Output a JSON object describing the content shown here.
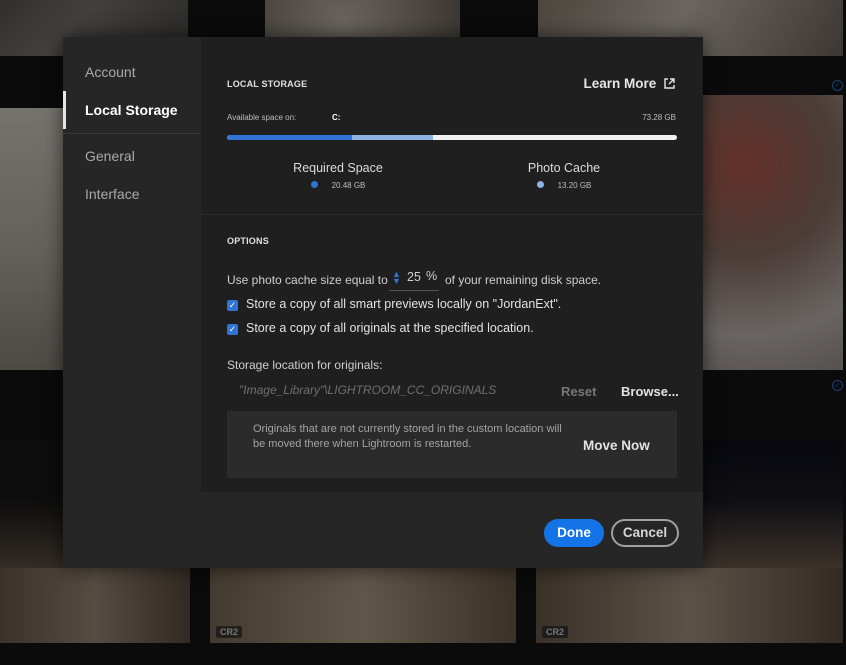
{
  "sidebar": {
    "items": [
      {
        "label": "Account",
        "active": false
      },
      {
        "label": "Local Storage",
        "active": true
      },
      {
        "label": "General",
        "active": false
      },
      {
        "label": "Interface",
        "active": false
      }
    ]
  },
  "local_storage": {
    "title": "LOCAL STORAGE",
    "learn_more": "Learn More",
    "available_label": "Available space on:",
    "drive": "C:",
    "available_value": "73.28 GB",
    "usage": {
      "required_fraction": 0.278,
      "cache_fraction": 0.18
    },
    "required_space": {
      "label": "Required Space",
      "value": "20.48 GB",
      "color": "#2f74d6"
    },
    "photo_cache": {
      "label": "Photo Cache",
      "value": "13.20 GB",
      "color": "#8db3e0"
    }
  },
  "options": {
    "title": "OPTIONS",
    "cache_prefix": "Use photo cache size equal to",
    "cache_value": "25",
    "cache_unit": "%",
    "cache_suffix": "of your remaining disk space.",
    "smart_previews_label": "Store a copy of all smart previews locally on \"JordanExt\".",
    "smart_previews_checked": true,
    "originals_label": "Store a copy of all originals at the specified location.",
    "originals_checked": true,
    "storage_location_label": "Storage location for originals:",
    "storage_path": "\"Image_Library\"\\LIGHTROOM_CC_ORIGINALS",
    "reset_label": "Reset",
    "browse_label": "Browse...",
    "note": "Originals that are not currently stored in the custom location will be moved there when Lightroom is restarted.",
    "move_now_label": "Move Now"
  },
  "footer": {
    "done_label": "Done",
    "cancel_label": "Cancel"
  },
  "background": {
    "badges": [
      "CR2",
      "CR2"
    ],
    "accent": "#2f74d6"
  }
}
